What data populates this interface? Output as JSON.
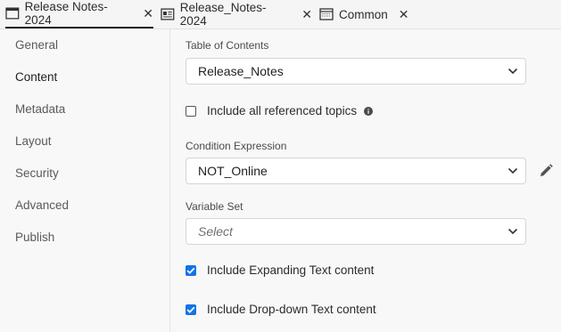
{
  "tabs": [
    {
      "label": "Release Notes-2024",
      "icon": "window-icon",
      "close": "✕"
    },
    {
      "label": "Release_Notes-2024",
      "icon": "document-icon",
      "close": "✕"
    },
    {
      "label": "Common",
      "icon": "grid-window-icon",
      "close": "✕"
    }
  ],
  "sidebar": {
    "items": [
      {
        "label": "General"
      },
      {
        "label": "Content"
      },
      {
        "label": "Metadata"
      },
      {
        "label": "Layout"
      },
      {
        "label": "Security"
      },
      {
        "label": "Advanced"
      },
      {
        "label": "Publish"
      }
    ],
    "selected": "Content"
  },
  "content": {
    "toc": {
      "label": "Table of Contents",
      "value": "Release_Notes"
    },
    "include_referenced": {
      "label": "Include all referenced topics",
      "checked": false
    },
    "condition": {
      "label": "Condition Expression",
      "value": "NOT_Online"
    },
    "variable_set": {
      "label": "Variable Set",
      "placeholder": "Select"
    },
    "include_expanding": {
      "label": "Include Expanding Text content",
      "checked": true
    },
    "include_dropdown": {
      "label": "Include Drop-down Text content",
      "checked": true
    }
  },
  "colors": {
    "accent": "#1473e6"
  }
}
